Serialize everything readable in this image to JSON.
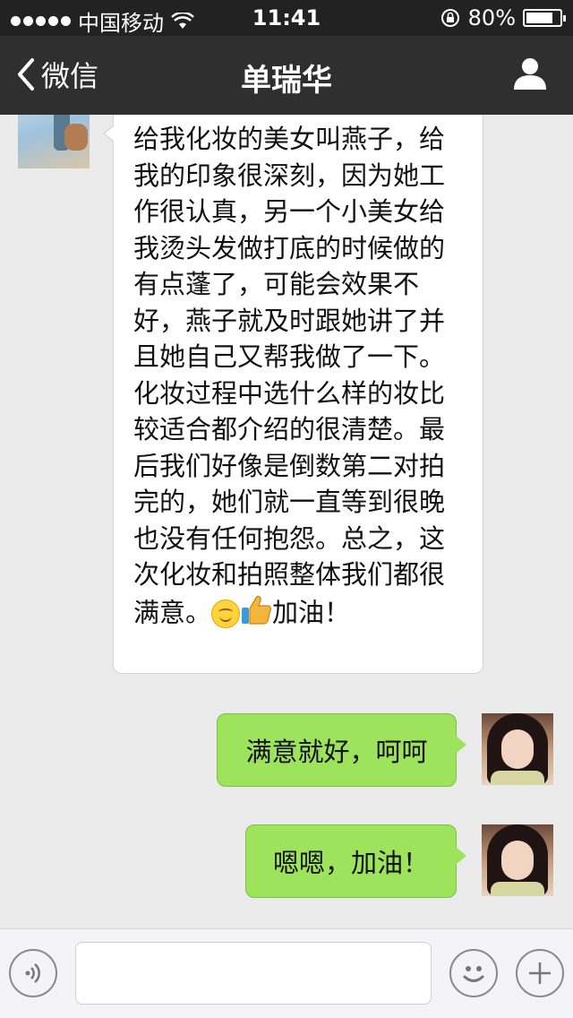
{
  "status_bar": {
    "carrier": "中国移动",
    "time": "11:41",
    "battery": "80%",
    "battery_level": 0.8
  },
  "nav": {
    "back_label": "微信",
    "title": "单瑞华"
  },
  "messages": [
    {
      "side": "received",
      "text": "给我化妆的美女叫燕子，给我的印象很深刻，因为她工作很认真，另一个小美女给我烫头发做打底的时候做的有点蓬了，可能会效果不好，燕子就及时跟她讲了并且她自己又帮我做了一下。化妆过程中选什么样的妆比较适合都介绍的很清楚。最后我们好像是倒数第二对拍完的，她们就一直等到很晚也没有任何抱怨。总之，这次化妆和拍照整体我们都很满意。",
      "emojis": [
        "smile-emoji",
        "thumbs-up-emoji"
      ],
      "tail_text": "加油！"
    },
    {
      "side": "sent",
      "text": "满意就好，呵呵"
    },
    {
      "side": "sent",
      "text": "嗯嗯，加油！"
    }
  ],
  "input": {
    "placeholder": ""
  },
  "colors": {
    "nav_bg": "#2f2f2f",
    "sent_bubble": "#9ee35c",
    "received_bubble": "#ffffff",
    "chat_bg": "#ebebeb"
  }
}
